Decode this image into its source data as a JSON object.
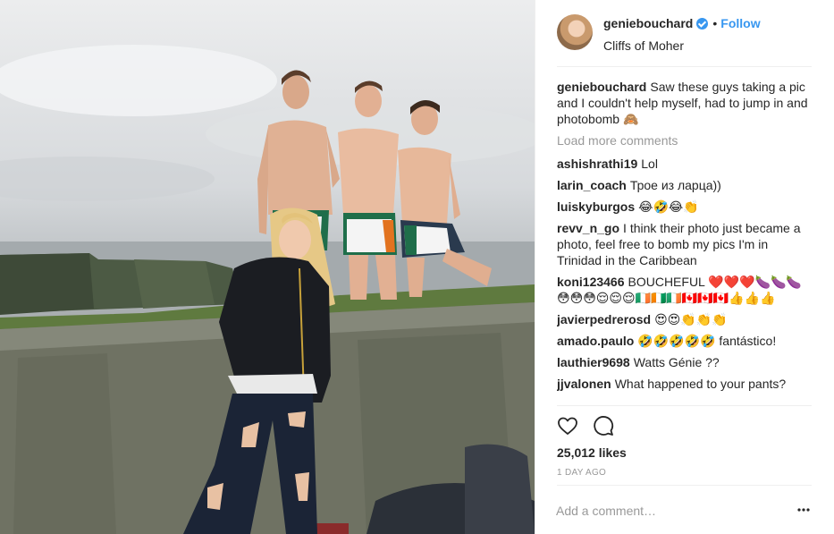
{
  "post": {
    "author": "geniebouchard",
    "verified_icon": "verified-badge-icon",
    "follow_label": "Follow",
    "separator": "•",
    "location": "Cliffs of Moher",
    "accent_color": "#3897f0",
    "caption_user": "geniebouchard",
    "caption_text": "Saw these guys taking a pic and I couldn't help myself, had to jump in and photobomb 🙈",
    "load_more_label": "Load more comments",
    "comments": [
      {
        "user": "ashishrathi19",
        "text": "Lol"
      },
      {
        "user": "larin_coach",
        "text": "Трое из ларца))"
      },
      {
        "user": "luiskyburgos",
        "text": "😂🤣😂👏"
      },
      {
        "user": "revv_n_go",
        "text": "I think their photo just became a photo, feel free to bomb my pics I'm in Trinidad in the Caribbean"
      },
      {
        "user": "koni123466",
        "text": "BOUCHEFUL ❤️❤️❤️🍆🍆🍆😳😳😳😌😌😌🇮🇪🇨🇮🇮🇪🇨🇦🇨🇦🇨🇦👍👍👍"
      },
      {
        "user": "javierpedrerosd",
        "text": "😍😍👏👏👏"
      },
      {
        "user": "amado.paulo",
        "text": "🤣🤣🤣🤣🤣 fantástico!"
      },
      {
        "user": "lauthier9698",
        "text": "Watts Génie ??"
      },
      {
        "user": "jjvalonen",
        "text": "What happened to your pants?"
      }
    ],
    "likes": "25,012 likes",
    "time_ago": "1 DAY AGO",
    "add_comment_placeholder": "Add a comment…",
    "icons": [
      "heart-icon",
      "comment-icon",
      "more-options-icon"
    ]
  }
}
